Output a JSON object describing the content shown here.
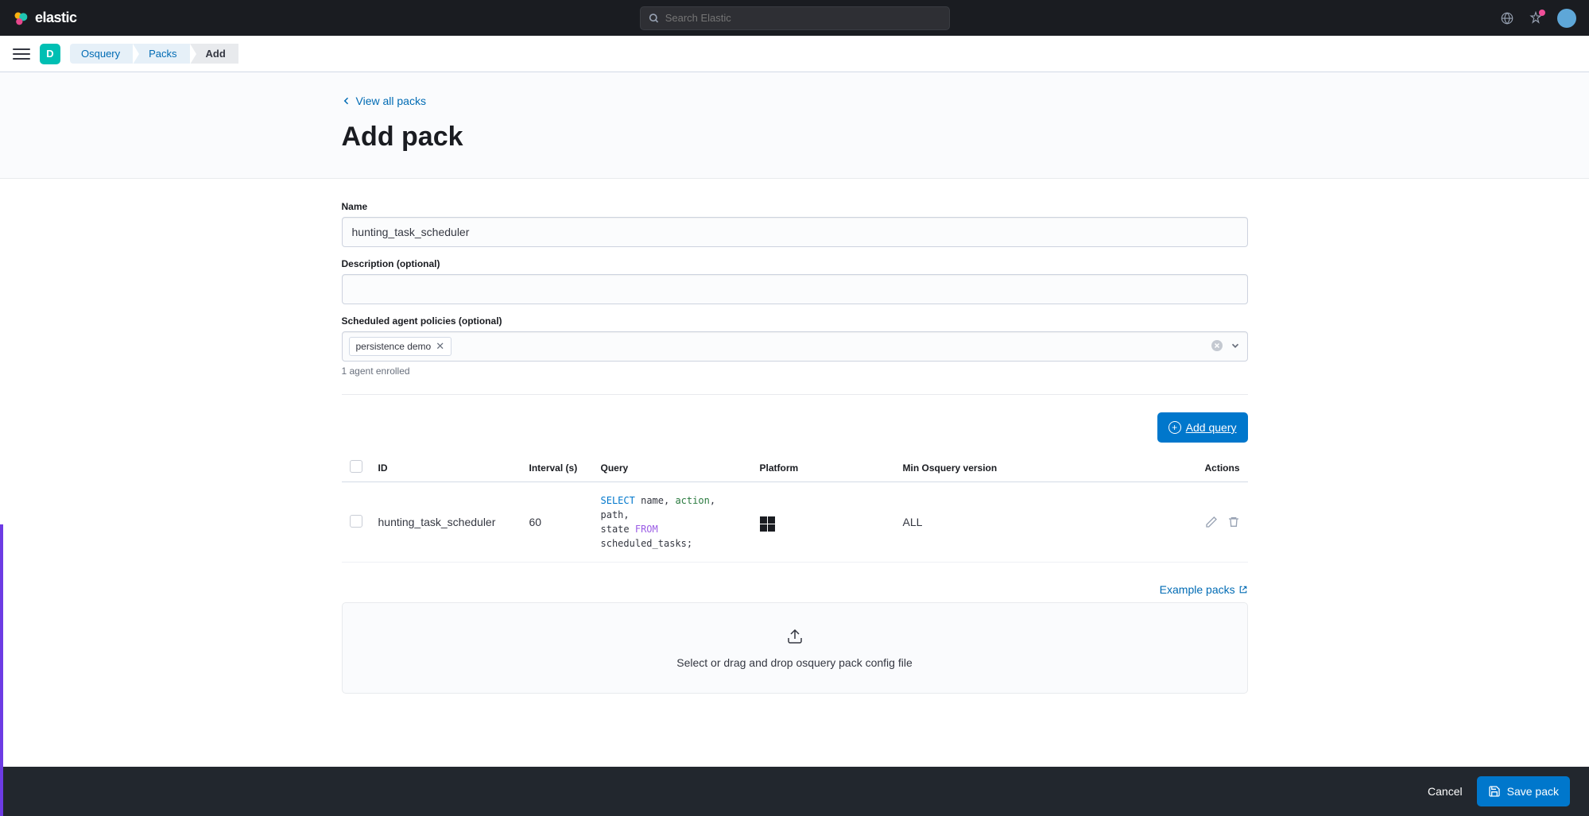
{
  "header": {
    "brand": "elastic",
    "search_placeholder": "Search Elastic",
    "space_letter": "D"
  },
  "breadcrumbs": {
    "items": [
      "Osquery",
      "Packs",
      "Add"
    ]
  },
  "page": {
    "back_link": "View all packs",
    "title": "Add pack"
  },
  "form": {
    "name_label": "Name",
    "name_value": "hunting_task_scheduler",
    "description_label": "Description (optional)",
    "description_value": "",
    "policies_label": "Scheduled agent policies (optional)",
    "policy_chip": "persistence demo",
    "help_text": "1 agent enrolled"
  },
  "table": {
    "add_query_btn": "Add query",
    "headers": {
      "id": "ID",
      "interval": "Interval (s)",
      "query": "Query",
      "platform": "Platform",
      "min_version": "Min Osquery version",
      "actions": "Actions"
    },
    "rows": [
      {
        "id": "hunting_task_scheduler",
        "interval": "60",
        "query_tokens": {
          "select": "SELECT",
          "name": "name",
          "action": "action",
          "path": "path",
          "state": "state",
          "from": "FROM",
          "table": "scheduled_tasks"
        },
        "platform": "windows",
        "min_version": "ALL"
      }
    ]
  },
  "example_packs_label": "Example packs",
  "dropzone_text": "Select or drag and drop osquery pack config file",
  "footer": {
    "cancel": "Cancel",
    "save": "Save pack"
  }
}
